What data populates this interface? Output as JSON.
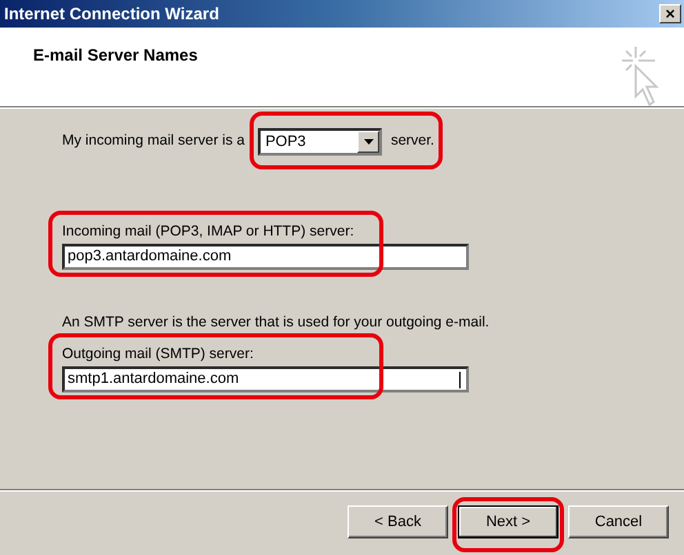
{
  "window": {
    "title": "Internet Connection Wizard",
    "close": "×"
  },
  "header": {
    "title": "E-mail Server Names"
  },
  "server_type": {
    "prefix": "My incoming mail server is a",
    "value": "POP3",
    "suffix": "server.",
    "highlighted": true
  },
  "incoming": {
    "label": "Incoming mail (POP3, IMAP or HTTP) server:",
    "value": "pop3.antardomaine.com",
    "highlighted": true
  },
  "smtp_note": "An SMTP server is the server that is used for your outgoing e-mail.",
  "outgoing": {
    "label": "Outgoing mail (SMTP) server:",
    "value": "smtp1.antardomaine.com",
    "highlighted": true
  },
  "buttons": [
    {
      "label": "< Back",
      "highlighted": false
    },
    {
      "label": "Next >",
      "default": true,
      "highlighted": true
    },
    {
      "label": "Cancel",
      "highlighted": false
    }
  ]
}
